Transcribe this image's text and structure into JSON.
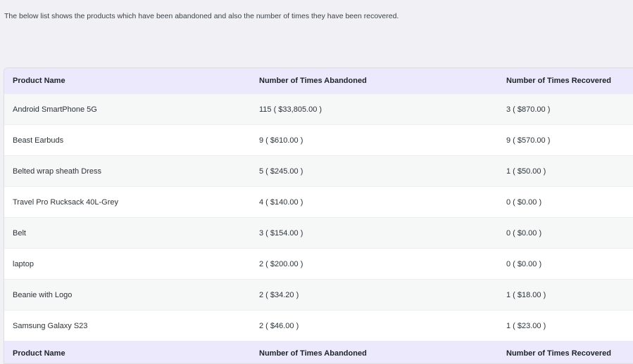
{
  "intro_text": "The below list shows the products which have been abandoned and also the number of times they have been recovered.",
  "table": {
    "headers": [
      "Product Name",
      "Number of Times Abandoned",
      "Number of Times Recovered"
    ],
    "rows": [
      [
        "Android SmartPhone 5G",
        "115 ( $33,805.00 )",
        "3 ( $870.00 )"
      ],
      [
        "Beast Earbuds",
        "9 ( $610.00 )",
        "9 ( $570.00 )"
      ],
      [
        "Belted wrap sheath Dress",
        "5 ( $245.00 )",
        "1 ( $50.00 )"
      ],
      [
        "Travel Pro Rucksack 40L-Grey",
        "4 ( $140.00 )",
        "0 ( $0.00 )"
      ],
      [
        "Belt",
        "3 ( $154.00 )",
        "0 ( $0.00 )"
      ],
      [
        "laptop",
        "2 ( $200.00 )",
        "0 ( $0.00 )"
      ],
      [
        "Beanie with Logo",
        "2 ( $34.20 )",
        "1 ( $18.00 )"
      ],
      [
        "Samsung Galaxy S23",
        "2 ( $46.00 )",
        "1 ( $23.00 )"
      ]
    ]
  },
  "colors": {
    "header_bg": "#ece9fd",
    "row_alt_bg": "#f6f7f7",
    "page_bg": "#f0f0f5"
  }
}
